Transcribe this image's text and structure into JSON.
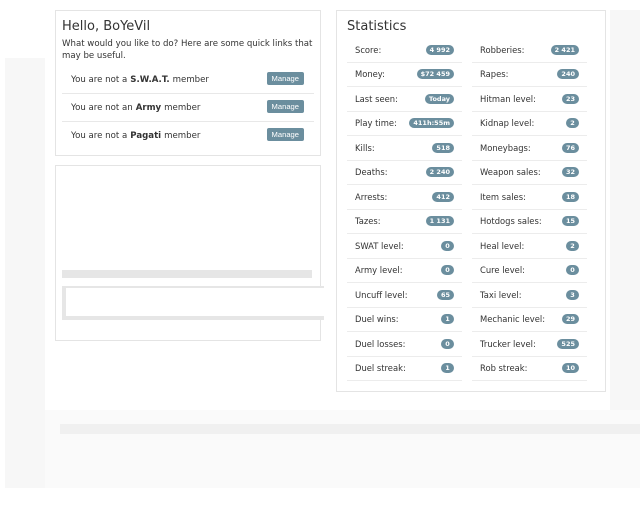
{
  "welcome": {
    "title": "Hello, BoYeVil",
    "intro": "What would you like to do? Here are some quick links that may be useful.",
    "memberships": [
      {
        "prefix": "You are not a",
        "group": "S.W.A.T.",
        "suffix": "member",
        "button": "Manage"
      },
      {
        "prefix": "You are not an",
        "group": "Army",
        "suffix": "member",
        "button": "Manage"
      },
      {
        "prefix": "You are not a",
        "group": "Pagati",
        "suffix": "member",
        "button": "Manage"
      }
    ]
  },
  "statistics": {
    "title": "Statistics",
    "left": [
      {
        "label": "Score:",
        "value": "4 992"
      },
      {
        "label": "Money:",
        "value": "$72 459"
      },
      {
        "label": "Last seen:",
        "value": "Today"
      },
      {
        "label": "Play time:",
        "value": "411h:55m"
      },
      {
        "label": "Kills:",
        "value": "518"
      },
      {
        "label": "Deaths:",
        "value": "2 240"
      },
      {
        "label": "Arrests:",
        "value": "412"
      },
      {
        "label": "Tazes:",
        "value": "1 131"
      },
      {
        "label": "SWAT level:",
        "value": "0"
      },
      {
        "label": "Army level:",
        "value": "0"
      },
      {
        "label": "Uncuff level:",
        "value": "65"
      },
      {
        "label": "Duel wins:",
        "value": "1"
      },
      {
        "label": "Duel losses:",
        "value": "0"
      },
      {
        "label": "Duel streak:",
        "value": "1"
      }
    ],
    "right": [
      {
        "label": "Robberies:",
        "value": "2 421"
      },
      {
        "label": "Rapes:",
        "value": "240"
      },
      {
        "label": "Hitman level:",
        "value": "23"
      },
      {
        "label": "Kidnap level:",
        "value": "2"
      },
      {
        "label": "Moneybags:",
        "value": "76"
      },
      {
        "label": "Weapon sales:",
        "value": "32"
      },
      {
        "label": "Item sales:",
        "value": "18"
      },
      {
        "label": "Hotdogs sales:",
        "value": "15"
      },
      {
        "label": "Heal level:",
        "value": "2"
      },
      {
        "label": "Cure level:",
        "value": "0"
      },
      {
        "label": "Taxi level:",
        "value": "3"
      },
      {
        "label": "Mechanic level:",
        "value": "29"
      },
      {
        "label": "Trucker level:",
        "value": "525"
      },
      {
        "label": "Rob streak:",
        "value": "10"
      }
    ]
  },
  "colors": {
    "badge": "#6b8e9e",
    "border": "#e4e4e4"
  }
}
